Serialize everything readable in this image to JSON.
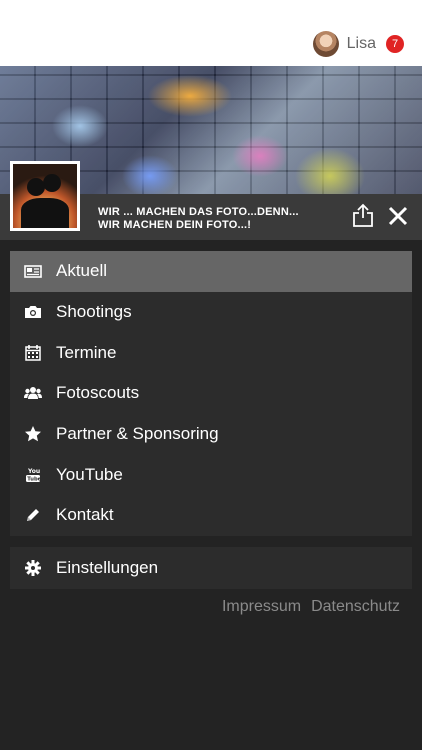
{
  "user": {
    "name": "Lisa",
    "notifications": "7"
  },
  "banner": {
    "slogan_line1": "WIR ... MACHEN DAS FOTO...DENN...",
    "slogan_line2": "WIR MACHEN DEIN FOTO...!"
  },
  "menu": {
    "items": [
      {
        "label": "Aktuell",
        "icon": "newspaper-icon"
      },
      {
        "label": "Shootings",
        "icon": "camera-icon"
      },
      {
        "label": "Termine",
        "icon": "calendar-icon"
      },
      {
        "label": "Fotoscouts",
        "icon": "users-icon"
      },
      {
        "label": "Partner & Sponsoring",
        "icon": "star-icon"
      },
      {
        "label": "YouTube",
        "icon": "youtube-icon"
      },
      {
        "label": "Kontakt",
        "icon": "pencil-icon"
      }
    ],
    "active_index": 0
  },
  "settings": {
    "label": "Einstellungen",
    "icon": "gear-icon"
  },
  "footer": {
    "impressum": "Impressum",
    "datenschutz": "Datenschutz"
  },
  "colors": {
    "badge": "#e02424",
    "active_item": "#666666",
    "menu_bg": "#2c2c2c",
    "page_bg": "#232323"
  }
}
